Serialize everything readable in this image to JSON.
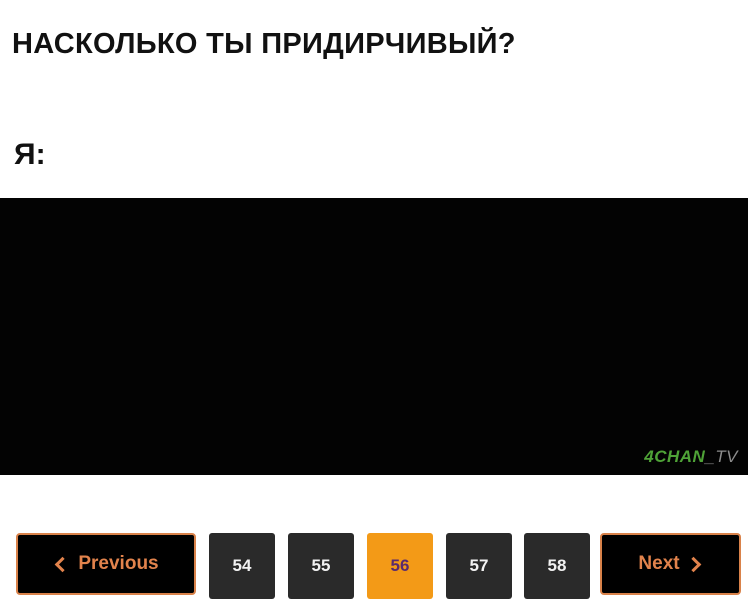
{
  "meme": {
    "question": "НАСКОЛЬКО ТЫ ПРИДИРЧИВЫЙ?",
    "me": "Я:"
  },
  "pagination": {
    "previous_label": "Previous",
    "next_label": "Next",
    "pages": [
      "54",
      "55",
      "56",
      "57",
      "58"
    ],
    "current_page": "56",
    "colors": {
      "accent": "#f39a17",
      "nav_border": "#d9824a",
      "page_bg": "#2a2a2a",
      "background": "#030303"
    },
    "icons": {
      "previous": "chevron-left-icon",
      "next": "chevron-right-icon"
    }
  },
  "watermark": {
    "brand": "4CHAN",
    "suffix": "_TV"
  }
}
